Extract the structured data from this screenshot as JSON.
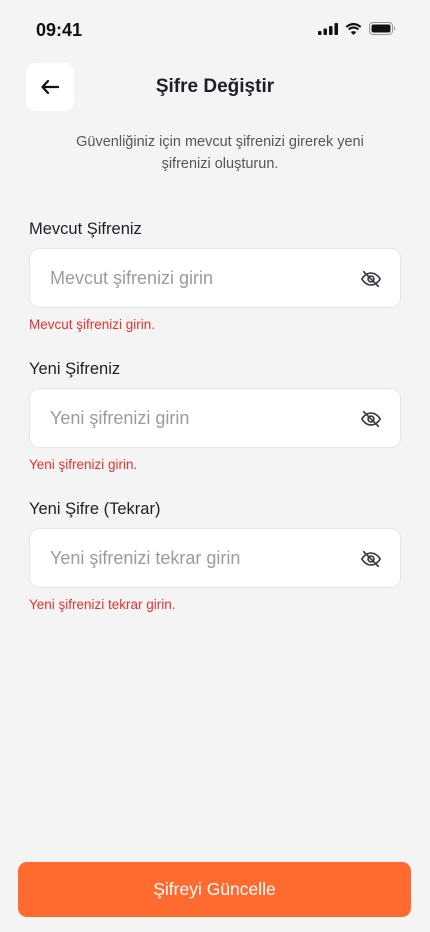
{
  "status_bar": {
    "time": "09:41",
    "icons": [
      "signal-icon",
      "wifi-icon",
      "battery-icon"
    ]
  },
  "header": {
    "back_icon": "arrow-left-icon",
    "title": "Şifre Değiştir"
  },
  "subtitle": "Güvenliğiniz için mevcut şifrenizi girerek yeni şifrenizi oluşturun.",
  "fields": [
    {
      "label": "Mevcut Şifreniz",
      "placeholder": "Mevcut şifrenizi girin",
      "value": "",
      "error": "Mevcut şifrenizi girin.",
      "toggle_icon": "eye-off-icon"
    },
    {
      "label": "Yeni Şifreniz",
      "placeholder": "Yeni şifrenizi girin",
      "value": "",
      "error": "Yeni şifrenizi girin.",
      "toggle_icon": "eye-off-icon"
    },
    {
      "label": "Yeni Şifre (Tekrar)",
      "placeholder": "Yeni şifrenizi tekrar girin",
      "value": "",
      "error": "Yeni şifrenizi tekrar girin.",
      "toggle_icon": "eye-off-icon"
    }
  ],
  "submit_label": "Şifreyi Güncelle",
  "colors": {
    "background": "#F4F4F4",
    "accent": "#FF6A2F",
    "error": "#E5322D",
    "text": "#1E1E2A"
  }
}
